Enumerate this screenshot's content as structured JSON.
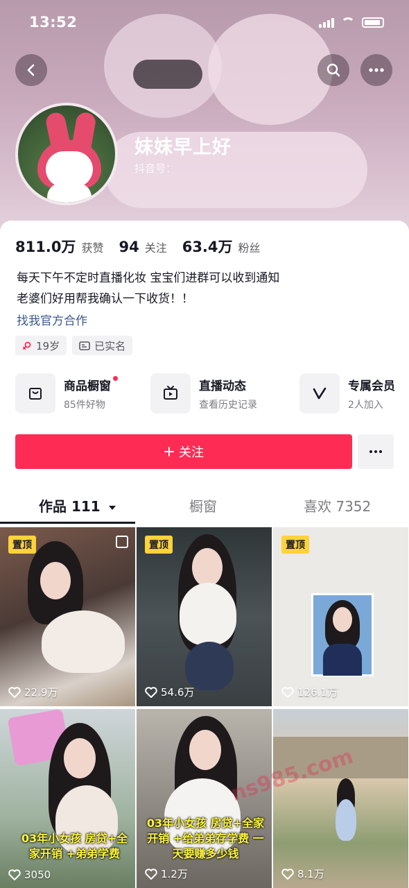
{
  "status_bar": {
    "time": "13:52"
  },
  "profile": {
    "nickname": "妹妹早上好",
    "account_label": "抖音号：",
    "stats": [
      {
        "value": "811.0万",
        "label": "获赞"
      },
      {
        "value": "94",
        "label": "关注"
      },
      {
        "value": "63.4万",
        "label": "粉丝"
      }
    ],
    "bio_lines": [
      "每天下午不定时直播化妆 宝宝们进群可以收到通知",
      "老婆们好用帮我确认一下收货！！"
    ],
    "link": "找我官方合作",
    "tags": [
      {
        "icon": "female-icon",
        "label": "19岁"
      },
      {
        "icon": "id-card-icon",
        "label": "已实名"
      }
    ]
  },
  "shortcuts": [
    {
      "icon": "shopping-bag-icon",
      "title": "商品橱窗",
      "subtitle": "85件好物",
      "has_dot": true
    },
    {
      "icon": "tv-icon",
      "title": "直播动态",
      "subtitle": "查看历史记录",
      "has_dot": false
    },
    {
      "icon": "v-badge-icon",
      "title": "专属会员",
      "subtitle": "2人加入",
      "has_dot": false
    }
  ],
  "follow_button": {
    "label": "关注",
    "icon": "plus"
  },
  "tabs": [
    {
      "label": "作品 111",
      "active": true
    },
    {
      "label": "橱窗",
      "active": false
    },
    {
      "label": "喜欢 7352",
      "active": false
    }
  ],
  "videos": [
    {
      "pinned": true,
      "pin_label": "置顶",
      "likes": "22.9万",
      "overlay": ""
    },
    {
      "pinned": true,
      "pin_label": "置顶",
      "likes": "54.6万",
      "overlay": ""
    },
    {
      "pinned": true,
      "pin_label": "置顶",
      "likes": "126.1万",
      "overlay": ""
    },
    {
      "pinned": false,
      "pin_label": "",
      "likes": "3050",
      "overlay": "03年小女孩 房贷+全家开销 +弟弟学费"
    },
    {
      "pinned": false,
      "pin_label": "",
      "likes": "1.2万",
      "overlay": "03年小女孩 房贷+全家开销 +给弟弟存学费 一天要赚多少钱"
    },
    {
      "pinned": false,
      "pin_label": "",
      "likes": "8.1万",
      "overlay": ""
    }
  ],
  "watermark": "ns985.com",
  "colors": {
    "accent": "#fe2c55",
    "pin": "#fdd23b",
    "link": "#3b5a8c"
  }
}
